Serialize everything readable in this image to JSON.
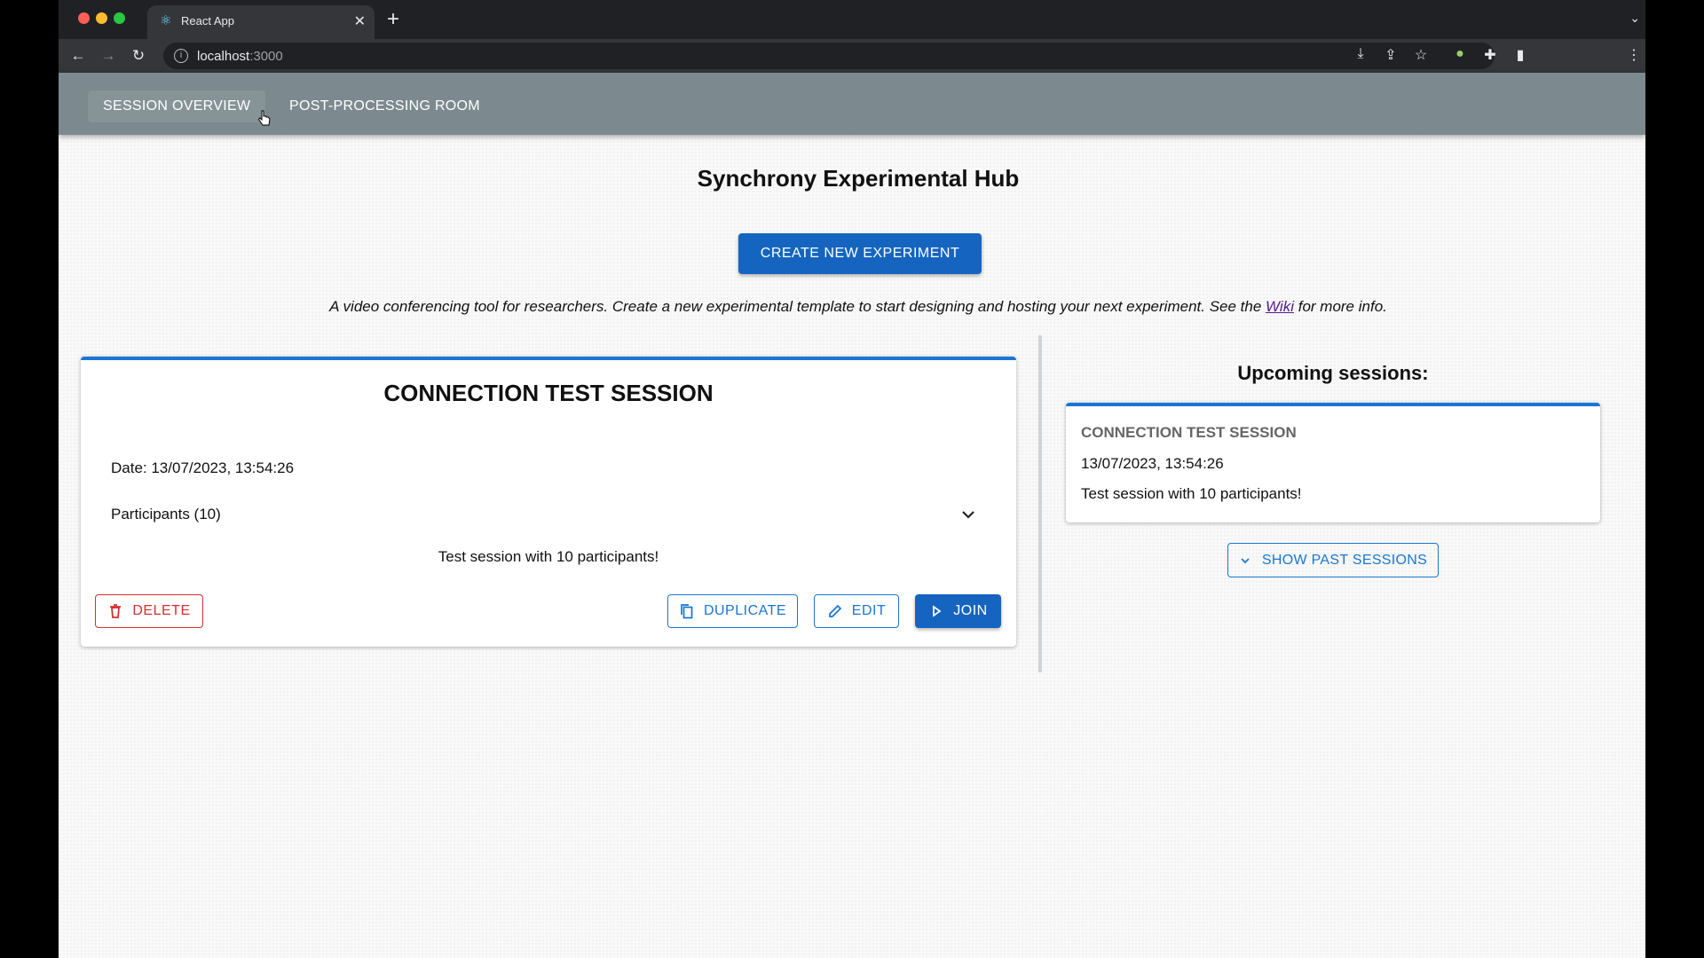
{
  "browser": {
    "tab_title": "React App",
    "url_host": "localhost",
    "url_port": ":3000"
  },
  "nav": {
    "tabs": [
      {
        "label": "SESSION OVERVIEW"
      },
      {
        "label": "POST-PROCESSING ROOM"
      }
    ]
  },
  "page": {
    "title": "Synchrony Experimental Hub",
    "create_button": "CREATE NEW EXPERIMENT",
    "description_before": "A video conferencing tool for researchers. Create a new experimental template to start designing and hosting your next experiment. See the",
    "description_link": "Wiki",
    "description_after": "for more info."
  },
  "session_card": {
    "title": "CONNECTION TEST SESSION",
    "date": "Date: 13/07/2023, 13:54:26",
    "participants": "Participants (10)",
    "description": "Test session with 10 participants!",
    "buttons": {
      "delete": "DELETE",
      "duplicate": "DUPLICATE",
      "edit": "EDIT",
      "join": "JOIN"
    }
  },
  "upcoming": {
    "heading": "Upcoming sessions:",
    "items": [
      {
        "name": "CONNECTION TEST SESSION",
        "date": "13/07/2023, 13:54:26",
        "description": "Test session with 10 participants!"
      }
    ],
    "show_past_button": "SHOW PAST SESSIONS"
  },
  "colors": {
    "appbar": "#7c8a8f",
    "primary": "#1565c0",
    "danger": "#d32f2f"
  },
  "icons": [
    "back-arrow-icon",
    "forward-arrow-icon",
    "reload-icon",
    "info-icon",
    "install-icon",
    "share-icon",
    "star-icon",
    "extension-icon",
    "puzzle-icon",
    "sidepanel-icon",
    "kebab-menu-icon",
    "trash-icon",
    "copy-icon",
    "pencil-icon",
    "play-icon",
    "chevron-down-icon"
  ]
}
